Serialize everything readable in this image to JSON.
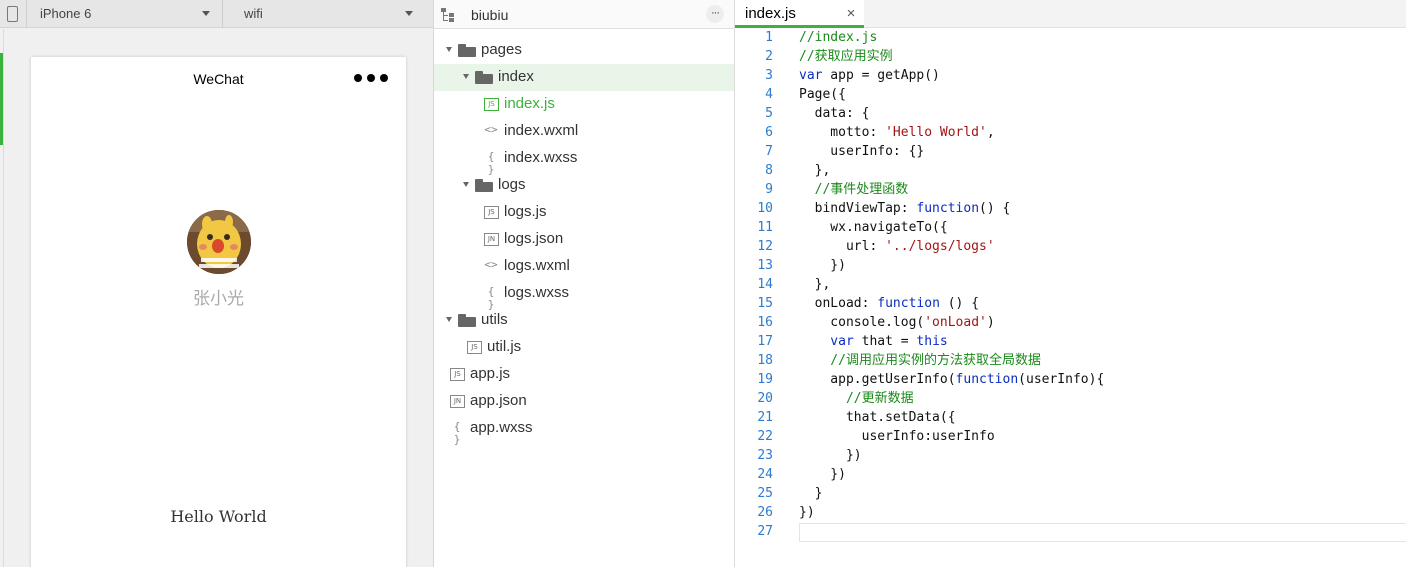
{
  "simulator": {
    "device": "iPhone 6",
    "network": "wifi",
    "nav_title": "WeChat",
    "nickname": "张小光",
    "motto": "Hello World"
  },
  "tree": {
    "project": "biubiu",
    "more_label": "···",
    "items": [
      {
        "label": "pages",
        "kind": "folder",
        "depth": 0,
        "expanded": true
      },
      {
        "label": "index",
        "kind": "folder",
        "depth": 1,
        "expanded": true,
        "selected": true
      },
      {
        "label": "index.js",
        "kind": "file",
        "badge": "JS",
        "depth": 2,
        "active": true
      },
      {
        "label": "index.wxml",
        "kind": "file",
        "glyph": "<>",
        "depth": 2
      },
      {
        "label": "index.wxss",
        "kind": "file",
        "glyph": "{ }",
        "depth": 2
      },
      {
        "label": "logs",
        "kind": "folder",
        "depth": 1,
        "expanded": true
      },
      {
        "label": "logs.js",
        "kind": "file",
        "badge": "JS",
        "depth": 2
      },
      {
        "label": "logs.json",
        "kind": "file",
        "badge": "JN",
        "depth": 2
      },
      {
        "label": "logs.wxml",
        "kind": "file",
        "glyph": "<>",
        "depth": 2
      },
      {
        "label": "logs.wxss",
        "kind": "file",
        "glyph": "{ }",
        "depth": 2
      },
      {
        "label": "utils",
        "kind": "folder",
        "depth": 0,
        "expanded": true
      },
      {
        "label": "util.js",
        "kind": "file",
        "badge": "JS",
        "depth": 1
      },
      {
        "label": "app.js",
        "kind": "file",
        "badge": "JS",
        "depth": 0
      },
      {
        "label": "app.json",
        "kind": "file",
        "badge": "JN",
        "depth": 0
      },
      {
        "label": "app.wxss",
        "kind": "file",
        "glyph": "{ }",
        "depth": 0
      }
    ]
  },
  "editor": {
    "tab_label": "index.js",
    "close_label": "×",
    "lines": [
      [
        [
          "cm",
          "//index.js"
        ]
      ],
      [
        [
          "cm",
          "//获取应用实例"
        ]
      ],
      [
        [
          "kw",
          "var"
        ],
        [
          "pl",
          " app = getApp()"
        ]
      ],
      [
        [
          "pl",
          "Page({"
        ]
      ],
      [
        [
          "pl",
          "  data: {"
        ]
      ],
      [
        [
          "pl",
          "    motto: "
        ],
        [
          "st",
          "'Hello World'"
        ],
        [
          "pl",
          ","
        ]
      ],
      [
        [
          "pl",
          "    userInfo: {}"
        ]
      ],
      [
        [
          "pl",
          "  },"
        ]
      ],
      [
        [
          "cm",
          "  //事件处理函数"
        ]
      ],
      [
        [
          "pl",
          "  bindViewTap: "
        ],
        [
          "kw",
          "function"
        ],
        [
          "pl",
          "() {"
        ]
      ],
      [
        [
          "pl",
          "    wx.navigateTo({"
        ]
      ],
      [
        [
          "pl",
          "      url: "
        ],
        [
          "st",
          "'../logs/logs'"
        ]
      ],
      [
        [
          "pl",
          "    })"
        ]
      ],
      [
        [
          "pl",
          "  },"
        ]
      ],
      [
        [
          "pl",
          "  onLoad: "
        ],
        [
          "kw",
          "function"
        ],
        [
          "pl",
          " () {"
        ]
      ],
      [
        [
          "pl",
          "    console.log("
        ],
        [
          "st",
          "'onLoad'"
        ],
        [
          "pl",
          ")"
        ]
      ],
      [
        [
          "kw",
          "    var"
        ],
        [
          "pl",
          " that = "
        ],
        [
          "kw",
          "this"
        ]
      ],
      [
        [
          "cm",
          "    //调用应用实例的方法获取全局数据"
        ]
      ],
      [
        [
          "pl",
          "    app.getUserInfo("
        ],
        [
          "kw",
          "function"
        ],
        [
          "pl",
          "(userInfo){"
        ]
      ],
      [
        [
          "cm",
          "      //更新数据"
        ]
      ],
      [
        [
          "pl",
          "      that.setData({"
        ]
      ],
      [
        [
          "pl",
          "        userInfo:userInfo"
        ]
      ],
      [
        [
          "pl",
          "      })"
        ]
      ],
      [
        [
          "pl",
          "    })"
        ]
      ],
      [
        [
          "pl",
          "  }"
        ]
      ],
      [
        [
          "pl",
          "})"
        ]
      ],
      [
        [
          "pl",
          ""
        ]
      ]
    ]
  },
  "colors": {
    "accent": "#3cb13c",
    "keyword": "#0a2dbf",
    "comment": "#1a8a1a",
    "string": "#a31515",
    "line_number": "#2b7bd1"
  }
}
